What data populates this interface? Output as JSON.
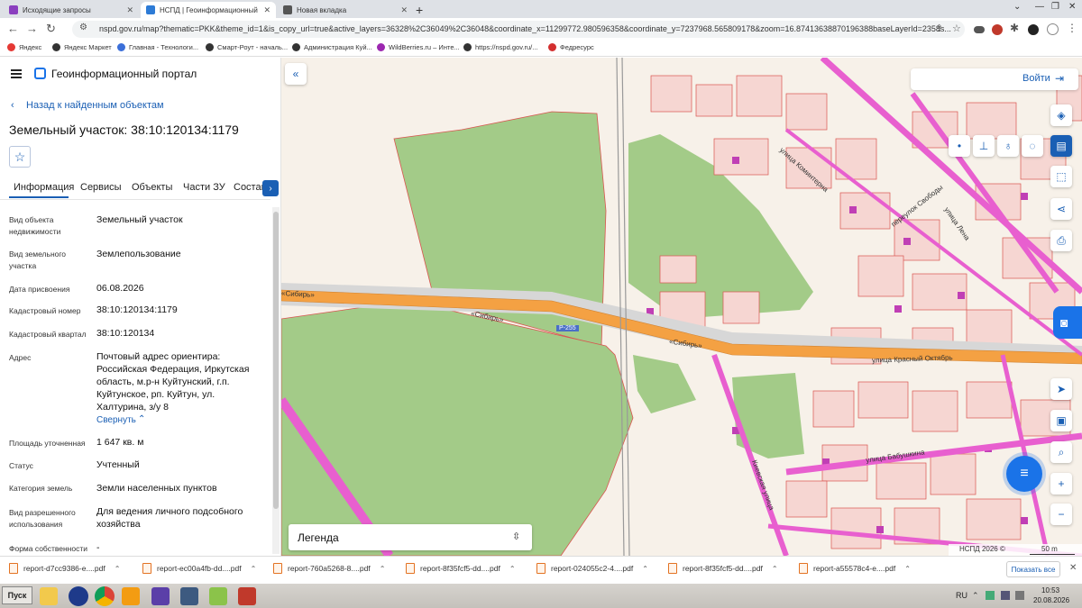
{
  "browser": {
    "tabs": [
      {
        "title": "Исходящие запросы",
        "color": "#8b3fbf",
        "active": false
      },
      {
        "title": "НСПД | Геоинформационный портал",
        "color": "#2d7bd6",
        "active": true
      },
      {
        "title": "Новая вкладка",
        "color": "#555555",
        "active": false
      }
    ],
    "new_tab": "+",
    "url": "nspd.gov.ru/map?thematic=PKK&theme_id=1&is_copy_url=true&active_layers=36328%2C36049%2C36048&coordinate_x=11299772.980596358&coordinate_y=7237968.565809178&zoom=16.87413638870196388baseLayerId=2358s...",
    "bookmarks": [
      "Яндекс",
      "Яндекс Маркет",
      "Главная - Технологи...",
      "Смарт-Роут - началь...",
      "Администрация Куй...",
      "WildBerries.ru – Инте...",
      "https://nspd.gov.ru/...",
      "Федресурс"
    ]
  },
  "portal": {
    "title": "Геоинформационный портал",
    "back_link": "Назад к найденным объектам",
    "object_title": "Земельный участок: 38:10:120134:1179",
    "tabs": [
      "Информация",
      "Сервисы",
      "Объекты",
      "Части ЗУ",
      "Состав"
    ],
    "fields": [
      {
        "label": "Вид объекта недвижимости",
        "value": "Земельный участок"
      },
      {
        "label": "Вид земельного участка",
        "value": "Землепользование"
      },
      {
        "label": "Дата присвоения",
        "value": "06.08.2026"
      },
      {
        "label": "Кадастровый номер",
        "value": "38:10:120134:1179"
      },
      {
        "label": "Кадастровый квартал",
        "value": "38:10:120134"
      },
      {
        "label": "Адрес",
        "value": "Почтовый адрес ориентира: Российская Федерация, Иркутская область, м.р-н Куйтунский, г.п. Куйтунское, рп. Куйтун, ул. Халтурина, з/у 8"
      },
      {
        "label": "Площадь уточненная",
        "value": "1 647 кв. м"
      },
      {
        "label": "Статус",
        "value": "Учтенный"
      },
      {
        "label": "Категория земель",
        "value": "Земли населенных пунктов"
      },
      {
        "label": "Вид разрешенного использования",
        "value": "Для ведения личного подсобного хозяйства"
      },
      {
        "label": "Форма собственности",
        "value": "-"
      }
    ],
    "collapse_link": "Свернуть"
  },
  "map": {
    "login": "Войти",
    "legend": "Легенда",
    "copyright": "НСПД 2026 ©",
    "scale": "50 m",
    "road_shield": "Р-255",
    "labels": {
      "sibir_left": "«Сибирь»",
      "sibir_mid": "«Сибирь»",
      "sibir_right": "«Сибирь»",
      "krasny": "улица Красный Октябрь",
      "kominterna": "улица Коминтерна",
      "svobody": "переулок Свободы",
      "lenina": "улица Лена",
      "babushkina": "улица Бабушкина",
      "kievskaya": "Киевская улица"
    },
    "colors": {
      "green": "#a3cb88",
      "road": "#f4a143",
      "pink": "#e85fcf",
      "parcel": "#d9544f"
    }
  },
  "downloads": {
    "items": [
      "report-d7cc9386-e....pdf",
      "report-ec00a4fb-dd....pdf",
      "report-760a5268-8....pdf",
      "report-8f35fcf5-dd....pdf",
      "report-024055c2-4....pdf",
      "report-8f35fcf5-dd....pdf",
      "report-a55578c4-e....pdf"
    ],
    "show_all": "Показать все"
  },
  "taskbar": {
    "start": "Пуск",
    "lang": "RU",
    "time": "10:53",
    "date": "20.08.2026"
  }
}
